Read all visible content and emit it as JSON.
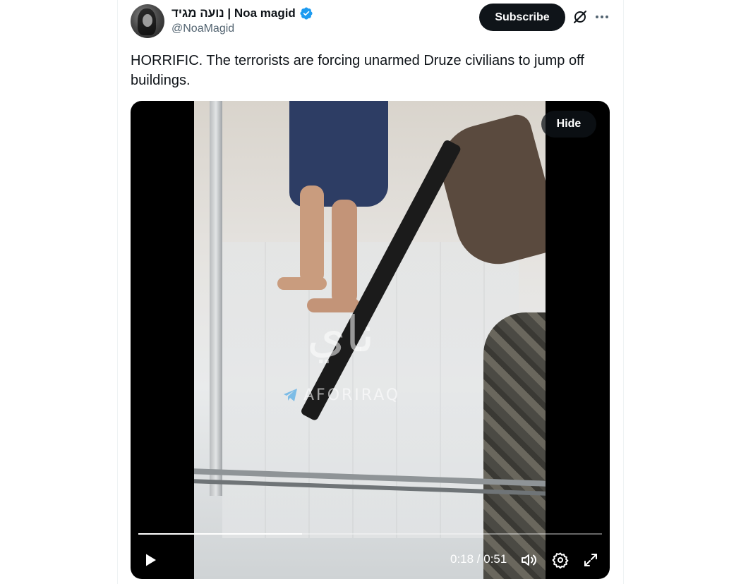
{
  "author": {
    "display_name": "נועה מגיד | Noa magid",
    "handle": "@NoaMagid",
    "verified": true,
    "verified_color": "#1d9bf0"
  },
  "actions": {
    "subscribe_label": "Subscribe",
    "grok_icon": "grok-icon",
    "more_icon": "more-icon"
  },
  "tweet": {
    "text": "HORRIFIC. The terrorists are forcing unarmed Druze civilians to jump off buildings."
  },
  "video": {
    "hide_label": "Hide",
    "watermark_arabic": "ناي",
    "watermark_tag": "AFORIRAQ",
    "current_time": "0:18",
    "duration": "0:51",
    "time_display": "0:18 / 0:51",
    "progress_fraction": 0.353,
    "controls": {
      "play_icon": "play-icon",
      "volume_icon": "volume-icon",
      "settings_icon": "gear-icon",
      "fullscreen_icon": "fullscreen-icon"
    }
  },
  "colors": {
    "text_primary": "#0f1419",
    "text_secondary": "#536471",
    "button_dark": "#0f1419",
    "verified_blue": "#1d9bf0"
  }
}
